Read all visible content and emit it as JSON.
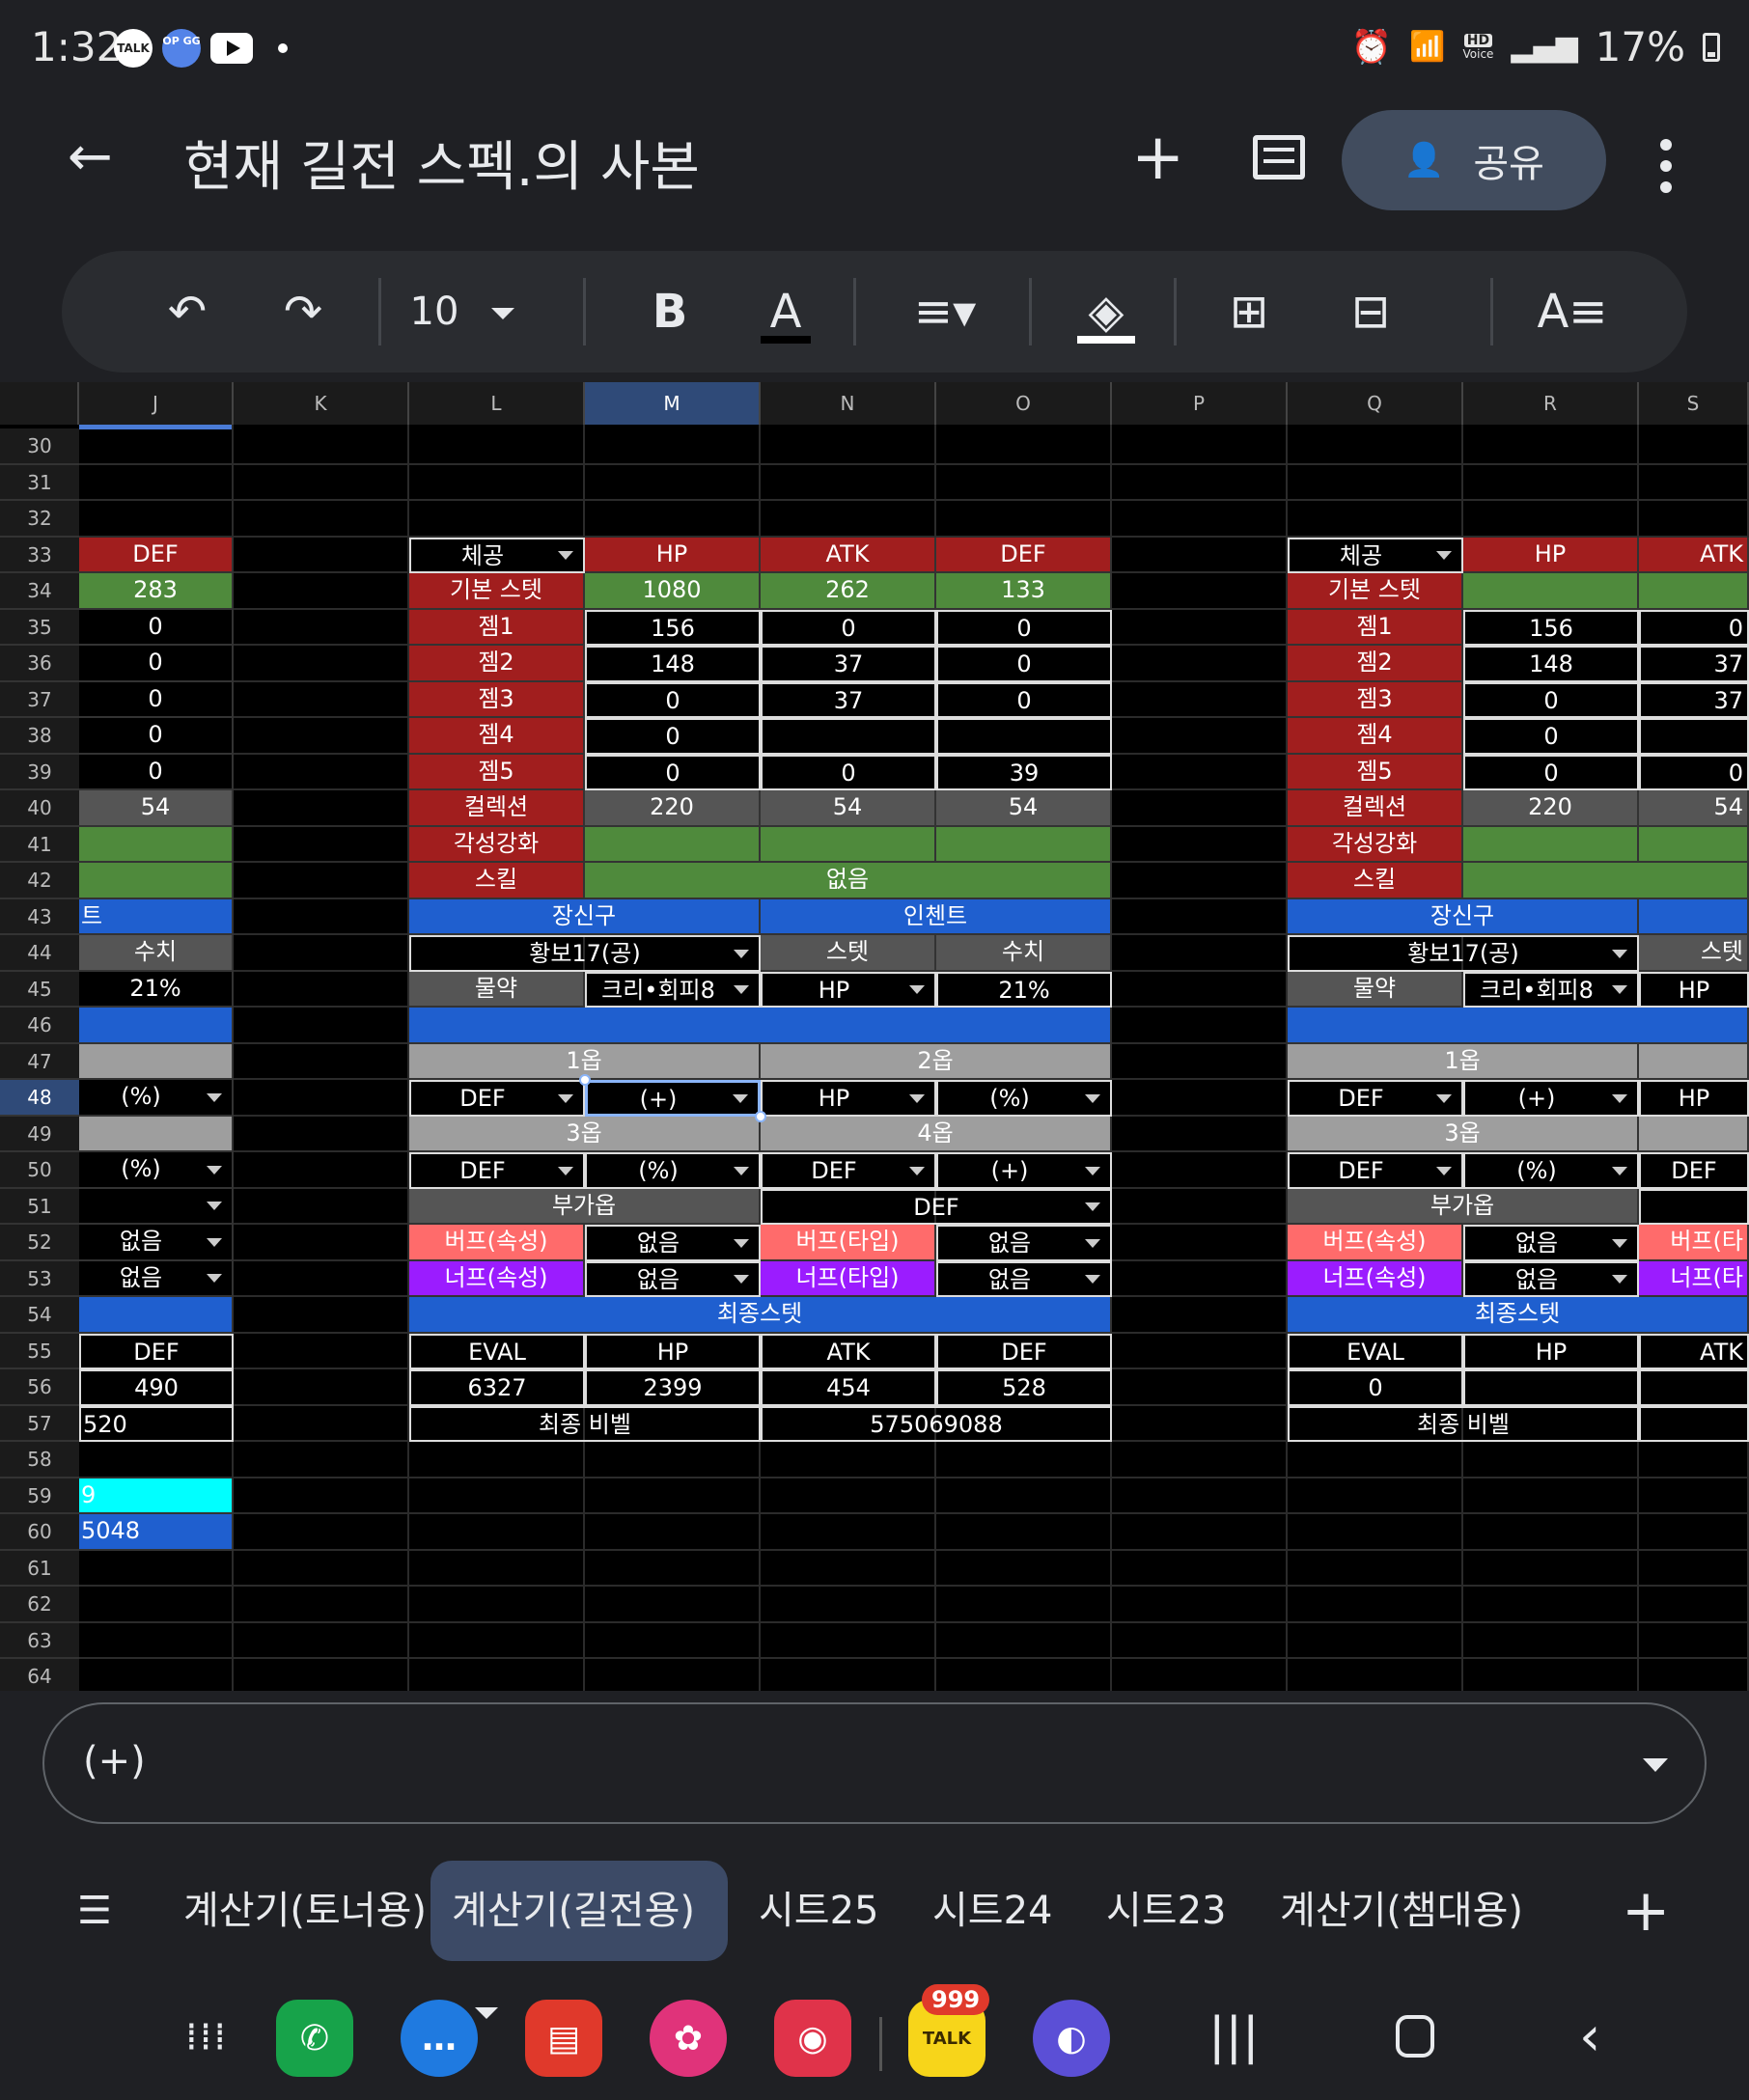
{
  "status": {
    "time": "1:32",
    "battery": "17%",
    "hd_label": "HD",
    "voice_label": "Voice",
    "talk_label": "TALK",
    "opgg_label": "OP GG"
  },
  "appbar": {
    "title": "현재 길전 스펙.의 사본",
    "share_label": "공유"
  },
  "toolbar": {
    "font_size": "10",
    "bold_label": "B",
    "text_color_label": "A"
  },
  "columns": [
    "J",
    "K",
    "L",
    "M",
    "N",
    "O",
    "P",
    "Q",
    "R",
    "S"
  ],
  "rows": [
    "30",
    "31",
    "32",
    "33",
    "34",
    "35",
    "36",
    "37",
    "38",
    "39",
    "40",
    "41",
    "42",
    "43",
    "44",
    "45",
    "46",
    "47",
    "48",
    "49",
    "50",
    "51",
    "52",
    "53",
    "54",
    "55",
    "56",
    "57",
    "58",
    "59",
    "60",
    "61",
    "62",
    "63",
    "64"
  ],
  "colors": {
    "red": "#a11e1e",
    "green": "#4f8a3c",
    "blue": "#1f5fcf",
    "gray": "#9e9e9e",
    "darkgray": "#555555",
    "buff": "#ff6b6b",
    "nerf": "#9b1cff",
    "cyan": "#00ffff",
    "active_col": "#2f4a78"
  },
  "cells": [
    {
      "r": 33,
      "c": "J",
      "t": "DEF",
      "bg": "red"
    },
    {
      "r": 34,
      "c": "J",
      "t": "283",
      "bg": "green"
    },
    {
      "r": 35,
      "c": "J",
      "t": "0"
    },
    {
      "r": 36,
      "c": "J",
      "t": "0"
    },
    {
      "r": 37,
      "c": "J",
      "t": "0"
    },
    {
      "r": 38,
      "c": "J",
      "t": "0"
    },
    {
      "r": 39,
      "c": "J",
      "t": "0"
    },
    {
      "r": 40,
      "c": "J",
      "t": "54",
      "bg": "darkgray"
    },
    {
      "r": 41,
      "c": "J",
      "t": "",
      "bg": "green"
    },
    {
      "r": 42,
      "c": "J",
      "t": "",
      "bg": "green"
    },
    {
      "r": 43,
      "c": "J",
      "t": "트",
      "bg": "blue",
      "a": "left"
    },
    {
      "r": 44,
      "c": "J",
      "t": "수치",
      "bg": "darkgray"
    },
    {
      "r": 45,
      "c": "J",
      "t": "21%"
    },
    {
      "r": 46,
      "c": "J",
      "t": "",
      "bg": "blue"
    },
    {
      "r": 47,
      "c": "J",
      "t": "",
      "bg": "gray"
    },
    {
      "r": 48,
      "c": "J",
      "t": "(%)",
      "dd": true
    },
    {
      "r": 49,
      "c": "J",
      "t": "",
      "bg": "gray"
    },
    {
      "r": 50,
      "c": "J",
      "t": "(%)",
      "dd": true
    },
    {
      "r": 51,
      "c": "J",
      "t": "",
      "dd": true
    },
    {
      "r": 52,
      "c": "J",
      "t": "없음",
      "dd": true
    },
    {
      "r": 53,
      "c": "J",
      "t": "없음",
      "dd": true
    },
    {
      "r": 54,
      "c": "J",
      "t": "",
      "bg": "blue"
    },
    {
      "r": 55,
      "c": "J",
      "t": "DEF",
      "bx": true
    },
    {
      "r": 56,
      "c": "J",
      "t": "490",
      "bx": true
    },
    {
      "r": 57,
      "c": "J",
      "t": "520",
      "bx": true,
      "a": "left"
    },
    {
      "r": 59,
      "c": "J",
      "t": "9",
      "bg": "cyan",
      "a": "left"
    },
    {
      "r": 60,
      "c": "J",
      "t": "5048",
      "bg": "blue",
      "a": "left"
    },
    {
      "r": 33,
      "c": "L",
      "t": "체공",
      "bx": true,
      "dd": true
    },
    {
      "r": 33,
      "c": "M",
      "t": "HP",
      "bg": "red"
    },
    {
      "r": 33,
      "c": "N",
      "t": "ATK",
      "bg": "red"
    },
    {
      "r": 33,
      "c": "O",
      "t": "DEF",
      "bg": "red"
    },
    {
      "r": 34,
      "c": "L",
      "t": "기본 스텟",
      "bg": "red"
    },
    {
      "r": 34,
      "c": "M",
      "t": "1080",
      "bg": "green"
    },
    {
      "r": 34,
      "c": "N",
      "t": "262",
      "bg": "green"
    },
    {
      "r": 34,
      "c": "O",
      "t": "133",
      "bg": "green"
    },
    {
      "r": 35,
      "c": "L",
      "t": "젬1",
      "bg": "red"
    },
    {
      "r": 35,
      "c": "M",
      "t": "156",
      "bx": true
    },
    {
      "r": 35,
      "c": "N",
      "t": "0",
      "bx": true
    },
    {
      "r": 35,
      "c": "O",
      "t": "0",
      "bx": true
    },
    {
      "r": 36,
      "c": "L",
      "t": "젬2",
      "bg": "red"
    },
    {
      "r": 36,
      "c": "M",
      "t": "148",
      "bx": true
    },
    {
      "r": 36,
      "c": "N",
      "t": "37",
      "bx": true
    },
    {
      "r": 36,
      "c": "O",
      "t": "0",
      "bx": true
    },
    {
      "r": 37,
      "c": "L",
      "t": "젬3",
      "bg": "red"
    },
    {
      "r": 37,
      "c": "M",
      "t": "0",
      "bx": true
    },
    {
      "r": 37,
      "c": "N",
      "t": "37",
      "bx": true
    },
    {
      "r": 37,
      "c": "O",
      "t": "0",
      "bx": true
    },
    {
      "r": 38,
      "c": "L",
      "t": "젬4",
      "bg": "red"
    },
    {
      "r": 38,
      "c": "M",
      "t": "0",
      "bx": true
    },
    {
      "r": 38,
      "c": "N",
      "t": "",
      "bx": true
    },
    {
      "r": 38,
      "c": "O",
      "t": "",
      "bx": true
    },
    {
      "r": 39,
      "c": "L",
      "t": "젬5",
      "bg": "red"
    },
    {
      "r": 39,
      "c": "M",
      "t": "0",
      "bx": true
    },
    {
      "r": 39,
      "c": "N",
      "t": "0",
      "bx": true
    },
    {
      "r": 39,
      "c": "O",
      "t": "39",
      "bx": true
    },
    {
      "r": 40,
      "c": "L",
      "t": "컬렉션",
      "bg": "red"
    },
    {
      "r": 40,
      "c": "M",
      "t": "220",
      "bg": "darkgray"
    },
    {
      "r": 40,
      "c": "N",
      "t": "54",
      "bg": "darkgray"
    },
    {
      "r": 40,
      "c": "O",
      "t": "54",
      "bg": "darkgray"
    },
    {
      "r": 41,
      "c": "L",
      "t": "각성강화",
      "bg": "red"
    },
    {
      "r": 41,
      "c": "M",
      "t": "",
      "bg": "green"
    },
    {
      "r": 41,
      "c": "N",
      "t": "",
      "bg": "green"
    },
    {
      "r": 41,
      "c": "O",
      "t": "",
      "bg": "green"
    },
    {
      "r": 42,
      "c": "L",
      "t": "스킬",
      "bg": "red"
    },
    {
      "r": 42,
      "c": "M",
      "t": "없음",
      "bg": "green",
      "span": 3
    },
    {
      "r": 43,
      "c": "L",
      "t": "장신구",
      "bg": "blue",
      "span": 2
    },
    {
      "r": 43,
      "c": "N",
      "t": "인첸트",
      "bg": "blue",
      "span": 2
    },
    {
      "r": 44,
      "c": "L",
      "t": "황보17(공)",
      "bx": true,
      "dd": true,
      "span": 2
    },
    {
      "r": 44,
      "c": "N",
      "t": "스텟",
      "bg": "darkgray"
    },
    {
      "r": 44,
      "c": "O",
      "t": "수치",
      "bg": "darkgray"
    },
    {
      "r": 45,
      "c": "L",
      "t": "물약",
      "bg": "darkgray"
    },
    {
      "r": 45,
      "c": "M",
      "t": "크리•회피8",
      "bx": true,
      "dd": true
    },
    {
      "r": 45,
      "c": "N",
      "t": "HP",
      "bx": true,
      "dd": true
    },
    {
      "r": 45,
      "c": "O",
      "t": "21%",
      "bx": true
    },
    {
      "r": 46,
      "c": "L",
      "t": "",
      "bg": "blue",
      "span": 4
    },
    {
      "r": 47,
      "c": "L",
      "t": "1옵",
      "bg": "gray",
      "span": 2
    },
    {
      "r": 47,
      "c": "N",
      "t": "2옵",
      "bg": "gray",
      "span": 2
    },
    {
      "r": 48,
      "c": "L",
      "t": "DEF",
      "bx": true,
      "dd": true
    },
    {
      "r": 48,
      "c": "M",
      "t": "(+)",
      "bx": true,
      "dd": true,
      "sel": true
    },
    {
      "r": 48,
      "c": "N",
      "t": "HP",
      "bx": true,
      "dd": true
    },
    {
      "r": 48,
      "c": "O",
      "t": "(%)",
      "bx": true,
      "dd": true
    },
    {
      "r": 49,
      "c": "L",
      "t": "3옵",
      "bg": "gray",
      "span": 2
    },
    {
      "r": 49,
      "c": "N",
      "t": "4옵",
      "bg": "gray",
      "span": 2
    },
    {
      "r": 50,
      "c": "L",
      "t": "DEF",
      "bx": true,
      "dd": true
    },
    {
      "r": 50,
      "c": "M",
      "t": "(%)",
      "bx": true,
      "dd": true
    },
    {
      "r": 50,
      "c": "N",
      "t": "DEF",
      "bx": true,
      "dd": true
    },
    {
      "r": 50,
      "c": "O",
      "t": "(+)",
      "bx": true,
      "dd": true
    },
    {
      "r": 51,
      "c": "L",
      "t": "부가옵",
      "bg": "darkgray",
      "span": 2
    },
    {
      "r": 51,
      "c": "N",
      "t": "DEF",
      "bx": true,
      "dd": true,
      "span": 2
    },
    {
      "r": 52,
      "c": "L",
      "t": "버프(속성)",
      "bg": "buff"
    },
    {
      "r": 52,
      "c": "M",
      "t": "없음",
      "bx": true,
      "dd": true
    },
    {
      "r": 52,
      "c": "N",
      "t": "버프(타입)",
      "bg": "buff"
    },
    {
      "r": 52,
      "c": "O",
      "t": "없음",
      "bx": true,
      "dd": true
    },
    {
      "r": 53,
      "c": "L",
      "t": "너프(속성)",
      "bg": "nerf"
    },
    {
      "r": 53,
      "c": "M",
      "t": "없음",
      "bx": true,
      "dd": true
    },
    {
      "r": 53,
      "c": "N",
      "t": "너프(타입)",
      "bg": "nerf"
    },
    {
      "r": 53,
      "c": "O",
      "t": "없음",
      "bx": true,
      "dd": true
    },
    {
      "r": 54,
      "c": "L",
      "t": "최종스텟",
      "bg": "blue",
      "span": 4
    },
    {
      "r": 55,
      "c": "L",
      "t": "EVAL",
      "bx": true
    },
    {
      "r": 55,
      "c": "M",
      "t": "HP",
      "bx": true
    },
    {
      "r": 55,
      "c": "N",
      "t": "ATK",
      "bx": true
    },
    {
      "r": 55,
      "c": "O",
      "t": "DEF",
      "bx": true
    },
    {
      "r": 56,
      "c": "L",
      "t": "6327",
      "bx": true
    },
    {
      "r": 56,
      "c": "M",
      "t": "2399",
      "bx": true
    },
    {
      "r": 56,
      "c": "N",
      "t": "454",
      "bx": true
    },
    {
      "r": 56,
      "c": "O",
      "t": "528",
      "bx": true
    },
    {
      "r": 57,
      "c": "L",
      "t": "최종 비벨",
      "bx": true,
      "span": 2
    },
    {
      "r": 57,
      "c": "N",
      "t": "575069088",
      "bx": true,
      "span": 2
    },
    {
      "r": 33,
      "c": "Q",
      "t": "체공",
      "bx": true,
      "dd": true
    },
    {
      "r": 33,
      "c": "R",
      "t": "HP",
      "bg": "red"
    },
    {
      "r": 33,
      "c": "S",
      "t": "ATK",
      "bg": "red",
      "a": "right"
    },
    {
      "r": 34,
      "c": "Q",
      "t": "기본 스텟",
      "bg": "red"
    },
    {
      "r": 34,
      "c": "R",
      "t": "",
      "bg": "green"
    },
    {
      "r": 34,
      "c": "S",
      "t": "",
      "bg": "green"
    },
    {
      "r": 35,
      "c": "Q",
      "t": "젬1",
      "bg": "red"
    },
    {
      "r": 35,
      "c": "R",
      "t": "156",
      "bx": true
    },
    {
      "r": 35,
      "c": "S",
      "t": "0",
      "bx": true,
      "a": "right"
    },
    {
      "r": 36,
      "c": "Q",
      "t": "젬2",
      "bg": "red"
    },
    {
      "r": 36,
      "c": "R",
      "t": "148",
      "bx": true
    },
    {
      "r": 36,
      "c": "S",
      "t": "37",
      "bx": true,
      "a": "right"
    },
    {
      "r": 37,
      "c": "Q",
      "t": "젬3",
      "bg": "red"
    },
    {
      "r": 37,
      "c": "R",
      "t": "0",
      "bx": true
    },
    {
      "r": 37,
      "c": "S",
      "t": "37",
      "bx": true,
      "a": "right"
    },
    {
      "r": 38,
      "c": "Q",
      "t": "젬4",
      "bg": "red"
    },
    {
      "r": 38,
      "c": "R",
      "t": "0",
      "bx": true
    },
    {
      "r": 38,
      "c": "S",
      "t": "",
      "bx": true
    },
    {
      "r": 39,
      "c": "Q",
      "t": "젬5",
      "bg": "red"
    },
    {
      "r": 39,
      "c": "R",
      "t": "0",
      "bx": true
    },
    {
      "r": 39,
      "c": "S",
      "t": "0",
      "bx": true,
      "a": "right"
    },
    {
      "r": 40,
      "c": "Q",
      "t": "컬렉션",
      "bg": "red"
    },
    {
      "r": 40,
      "c": "R",
      "t": "220",
      "bg": "darkgray"
    },
    {
      "r": 40,
      "c": "S",
      "t": "54",
      "bg": "darkgray",
      "a": "right"
    },
    {
      "r": 41,
      "c": "Q",
      "t": "각성강화",
      "bg": "red"
    },
    {
      "r": 41,
      "c": "R",
      "t": "",
      "bg": "green"
    },
    {
      "r": 41,
      "c": "S",
      "t": "",
      "bg": "green"
    },
    {
      "r": 42,
      "c": "Q",
      "t": "스킬",
      "bg": "red"
    },
    {
      "r": 42,
      "c": "R",
      "t": "",
      "bg": "green",
      "span": 2
    },
    {
      "r": 43,
      "c": "Q",
      "t": "장신구",
      "bg": "blue",
      "span": 2
    },
    {
      "r": 43,
      "c": "S",
      "t": "",
      "bg": "blue"
    },
    {
      "r": 44,
      "c": "Q",
      "t": "황보17(공)",
      "bx": true,
      "dd": true,
      "span": 2
    },
    {
      "r": 44,
      "c": "S",
      "t": "스텟",
      "bg": "darkgray",
      "a": "right"
    },
    {
      "r": 45,
      "c": "Q",
      "t": "물약",
      "bg": "darkgray"
    },
    {
      "r": 45,
      "c": "R",
      "t": "크리•회피8",
      "bx": true,
      "dd": true
    },
    {
      "r": 45,
      "c": "S",
      "t": "HP",
      "bx": true
    },
    {
      "r": 46,
      "c": "Q",
      "t": "",
      "bg": "blue",
      "span": 3
    },
    {
      "r": 47,
      "c": "Q",
      "t": "1옵",
      "bg": "gray",
      "span": 2
    },
    {
      "r": 47,
      "c": "S",
      "t": "",
      "bg": "gray"
    },
    {
      "r": 48,
      "c": "Q",
      "t": "DEF",
      "bx": true,
      "dd": true
    },
    {
      "r": 48,
      "c": "R",
      "t": "(+)",
      "bx": true,
      "dd": true
    },
    {
      "r": 48,
      "c": "S",
      "t": "HP",
      "bx": true
    },
    {
      "r": 49,
      "c": "Q",
      "t": "3옵",
      "bg": "gray",
      "span": 2
    },
    {
      "r": 49,
      "c": "S",
      "t": "",
      "bg": "gray"
    },
    {
      "r": 50,
      "c": "Q",
      "t": "DEF",
      "bx": true,
      "dd": true
    },
    {
      "r": 50,
      "c": "R",
      "t": "(%)",
      "bx": true,
      "dd": true
    },
    {
      "r": 50,
      "c": "S",
      "t": "DEF",
      "bx": true
    },
    {
      "r": 51,
      "c": "Q",
      "t": "부가옵",
      "bg": "darkgray",
      "span": 2
    },
    {
      "r": 51,
      "c": "S",
      "t": "",
      "bx": true
    },
    {
      "r": 52,
      "c": "Q",
      "t": "버프(속성)",
      "bg": "buff"
    },
    {
      "r": 52,
      "c": "R",
      "t": "없음",
      "bx": true,
      "dd": true
    },
    {
      "r": 52,
      "c": "S",
      "t": "버프(타",
      "bg": "buff",
      "a": "right"
    },
    {
      "r": 53,
      "c": "Q",
      "t": "너프(속성)",
      "bg": "nerf"
    },
    {
      "r": 53,
      "c": "R",
      "t": "없음",
      "bx": true,
      "dd": true
    },
    {
      "r": 53,
      "c": "S",
      "t": "너프(타",
      "bg": "nerf",
      "a": "right"
    },
    {
      "r": 54,
      "c": "Q",
      "t": "최종스텟",
      "bg": "blue",
      "span": 3
    },
    {
      "r": 55,
      "c": "Q",
      "t": "EVAL",
      "bx": true
    },
    {
      "r": 55,
      "c": "R",
      "t": "HP",
      "bx": true
    },
    {
      "r": 55,
      "c": "S",
      "t": "ATK",
      "bx": true,
      "a": "right"
    },
    {
      "r": 56,
      "c": "Q",
      "t": "0",
      "bx": true
    },
    {
      "r": 56,
      "c": "R",
      "t": "",
      "bx": true
    },
    {
      "r": 56,
      "c": "S",
      "t": "",
      "bx": true
    },
    {
      "r": 57,
      "c": "Q",
      "t": "최종 비벨",
      "bx": true,
      "span": 2
    },
    {
      "r": 57,
      "c": "S",
      "t": "",
      "bx": true
    }
  ],
  "formula_bar": {
    "value": "(+)"
  },
  "sheet_tabs": [
    "계산기(토너용)",
    "계산기(길전용)",
    "시트25",
    "시트24",
    "시트23",
    "계산기(챔대용)"
  ],
  "active_tab": "계산기(길전용)",
  "nav": {
    "badge": "999",
    "talk_label": "TALK"
  }
}
